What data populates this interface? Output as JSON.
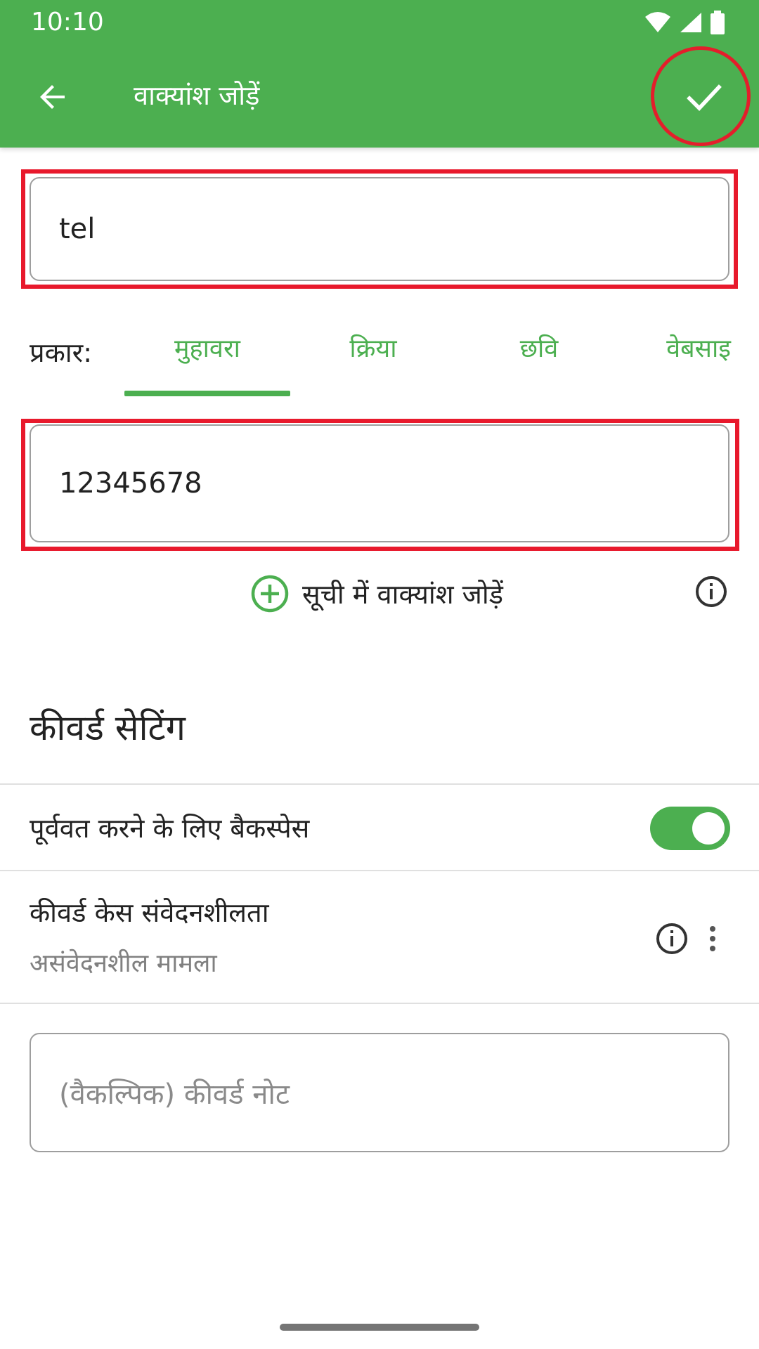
{
  "status_bar": {
    "time": "10:10",
    "icons": [
      "wifi-icon",
      "signal-icon",
      "battery-icon"
    ]
  },
  "app_bar": {
    "title": "वाक्यांश जोड़ें",
    "back_icon": "arrow-back-icon",
    "confirm_icon": "check-icon"
  },
  "keyword_input": {
    "value": "tel"
  },
  "type_selector": {
    "label": "प्रकार:",
    "tabs": [
      {
        "label": "मुहावरा",
        "selected": true
      },
      {
        "label": "क्रिया",
        "selected": false
      },
      {
        "label": "छवि",
        "selected": false
      },
      {
        "label": "वेबसाइ",
        "selected": false
      }
    ]
  },
  "phrase_input": {
    "value": "12345678"
  },
  "add_to_list": {
    "label": "सूची में वाक्यांश जोड़ें",
    "icon": "add-circle-icon",
    "info_icon": "info-icon"
  },
  "keyword_settings": {
    "title": "कीवर्ड सेटिंग",
    "backspace_undo": {
      "label": "पूर्ववत करने के लिए बैकस्पेस",
      "enabled": true
    },
    "case_sensitivity": {
      "label": "कीवर्ड केस संवेदनशीलता",
      "value": "असंवेदनशील मामला"
    }
  },
  "note_input": {
    "placeholder": "(वैकल्पिक) कीवर्ड नोट"
  },
  "colors": {
    "primary": "#4caf50",
    "highlight": "#e8192c"
  }
}
